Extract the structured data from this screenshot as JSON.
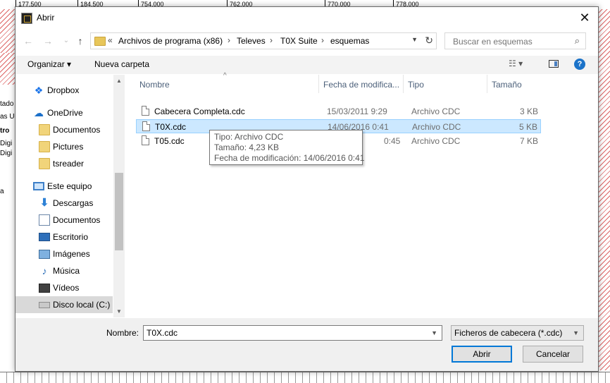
{
  "background": {
    "ruler_ticks": [
      "177.500",
      "184.500",
      "754.000",
      "762.000",
      "770.000",
      "778.000"
    ],
    "left_panel_texts": [
      "tado",
      "as U",
      "tro",
      "Digi",
      "Digi",
      "a"
    ]
  },
  "dialog": {
    "title": "Abrir",
    "close_label": "✕"
  },
  "navigation": {
    "back": "←",
    "forward": "→",
    "recent": "⌄",
    "up": "↑",
    "breadcrumb": [
      "Archivos de programa (x86)",
      "Televes",
      "T0X Suite",
      "esquemas"
    ],
    "breadcrumb_overflow": "«",
    "separator": "›",
    "refresh": "↻",
    "search_placeholder": "Buscar en esquemas",
    "search_icon": "search-icon"
  },
  "toolbar": {
    "organize_label": "Organizar ▾",
    "new_folder_label": "Nueva carpeta",
    "view_label": "☷ ▾",
    "help_label": "?"
  },
  "sidebar": {
    "items": [
      {
        "label": "Dropbox",
        "icon": "dropbox-icon"
      },
      {
        "label": "OneDrive",
        "icon": "cloud-icon"
      },
      {
        "label": "Documentos",
        "icon": "folder-icon"
      },
      {
        "label": "Pictures",
        "icon": "folder-icon"
      },
      {
        "label": "tsreader",
        "icon": "folder-icon"
      },
      {
        "label": "Este equipo",
        "icon": "computer-icon"
      },
      {
        "label": "Descargas",
        "icon": "download-icon"
      },
      {
        "label": "Documentos",
        "icon": "documents-icon"
      },
      {
        "label": "Escritorio",
        "icon": "desktop-icon"
      },
      {
        "label": "Imágenes",
        "icon": "images-icon"
      },
      {
        "label": "Música",
        "icon": "music-icon"
      },
      {
        "label": "Vídeos",
        "icon": "videos-icon"
      },
      {
        "label": "Disco local (C:)",
        "icon": "disk-icon",
        "selected": true
      }
    ],
    "scroll_up": "▲",
    "scroll_down": "▼"
  },
  "file_list": {
    "columns": [
      "Nombre",
      "Fecha de modifica...",
      "Tipo",
      "Tamaño"
    ],
    "sort_indicator": "^",
    "rows": [
      {
        "name": "Cabecera Completa.cdc",
        "date": "15/03/2011 9:29",
        "type": "Archivo CDC",
        "size": "3 KB"
      },
      {
        "name": "T0X.cdc",
        "date": "14/06/2016 0:41",
        "type": "Archivo CDC",
        "size": "5 KB",
        "selected": true
      },
      {
        "name": "T05.cdc",
        "date": "0:45",
        "type": "Archivo CDC",
        "size": "7 KB"
      }
    ]
  },
  "tooltip": {
    "lines": [
      "Tipo: Archivo CDC",
      "Tamaño: 4,23 KB",
      "Fecha de modificación: 14/06/2016 0:41"
    ]
  },
  "footer": {
    "name_label": "Nombre:",
    "name_value": "T0X.cdc",
    "filter_value": "Ficheros de cabecera (*.cdc)",
    "open_label": "Abrir",
    "cancel_label": "Cancelar"
  },
  "colors": {
    "accent": "#0078d7",
    "selection_bg": "#cce8ff",
    "hatch": "#d66666"
  }
}
